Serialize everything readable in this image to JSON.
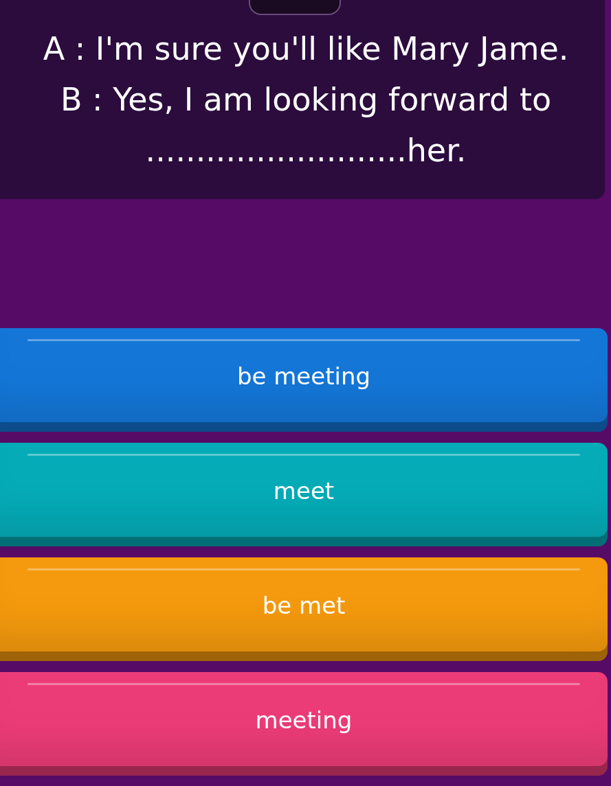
{
  "question": {
    "text": "A : I'm sure you'll like Mary Jame. B : Yes, I am looking forward to ..........................her."
  },
  "answers": [
    {
      "label": "be meeting",
      "color": "#1477d8"
    },
    {
      "label": "meet",
      "color": "#05acb8"
    },
    {
      "label": "be met",
      "color": "#f59a0e"
    },
    {
      "label": "meeting",
      "color": "#ec3c78"
    }
  ]
}
